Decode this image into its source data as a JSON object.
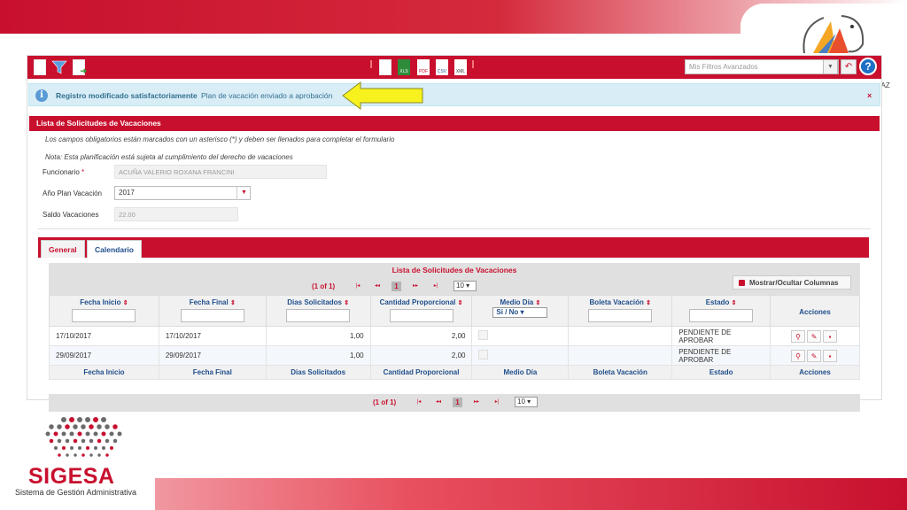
{
  "colors": {
    "brand_red": "#c8102e",
    "info_bg": "#d9edf7",
    "link_blue": "#1f4e8c"
  },
  "branding": {
    "name": "SIGESA",
    "subtitle": "Sistema de Gestión Administrativa"
  },
  "toolbar": {
    "icons": [
      "new-document-icon",
      "filter-icon",
      "export-document-icon",
      "document-icon",
      "xls-icon",
      "pdf-icon",
      "csv-icon",
      "xml-icon"
    ],
    "export_labels": [
      "XLS",
      "PDF",
      "CSV",
      "XML"
    ],
    "filters_placeholder": "Mis Filtros Avanzados",
    "help_label": "?",
    "edge_text": "'AZ"
  },
  "message": {
    "strong": "Registro modificado satisfactoriamente",
    "detail": "Plan de vacación enviado a aprobación",
    "close": "×"
  },
  "form": {
    "title": "Lista de Solicitudes de Vacaciones",
    "required_note": "Los campos obligatorios están marcados con un asterisco (*) y deben ser llenados para completar el formulario",
    "plan_note": "Nota: Esta planificación está sujeta al cumplimiento del derecho de vacaciones",
    "funcionario_label": "Funcionario",
    "funcionario_required": "*",
    "funcionario_value": "ACUÑA VALERIO ROXANA FRANCINI",
    "anio_label": "Año Plan Vacación",
    "anio_value": "2017",
    "saldo_label": "Saldo Vacaciones",
    "saldo_value": "22.00"
  },
  "tabs": [
    "General",
    "Calendario"
  ],
  "table": {
    "title": "Lista de Solicitudes de Vacaciones",
    "page_info": "(1 of 1)",
    "current_page": "1",
    "rows_per_page": "10",
    "toggle_columns": "Mostrar/Ocultar Columnas",
    "columns": [
      "Fecha Inicio",
      "Fecha Final",
      "Dias Solicitados",
      "Cantidad Proporcional",
      "Medio Día",
      "Boleta Vacación",
      "Estado",
      "Acciones"
    ],
    "footer_columns": [
      "Fecha Inicio",
      "Fecha Final",
      "Dias Solicitados",
      "Cantidad Proporcional",
      "Medio Día",
      "Boleta Vacación",
      "Estado",
      "Acciones"
    ],
    "medio_dia_filter": "Si / No",
    "rows": [
      {
        "fecha_inicio": "17/10/2017",
        "fecha_final": "17/10/2017",
        "dias": "1,00",
        "cantidad": "2,00",
        "estado": "PENDIENTE DE APROBAR"
      },
      {
        "fecha_inicio": "29/09/2017",
        "fecha_final": "29/09/2017",
        "dias": "1,00",
        "cantidad": "2,00",
        "estado": "PENDIENTE DE APROBAR"
      }
    ]
  }
}
